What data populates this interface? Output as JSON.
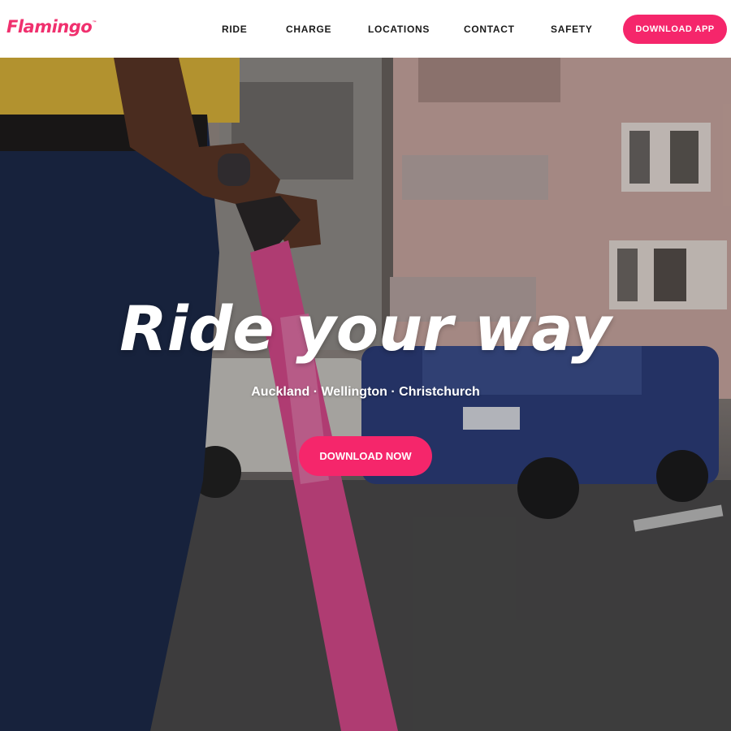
{
  "brand": {
    "name": "Flamingo",
    "trademark": "™",
    "color": "#f0306e"
  },
  "nav": {
    "items": [
      {
        "label": "RIDE"
      },
      {
        "label": "CHARGE"
      },
      {
        "label": "LOCATIONS"
      },
      {
        "label": "CONTACT"
      },
      {
        "label": "SAFETY"
      }
    ],
    "cta_label": "DOWNLOAD APP"
  },
  "hero": {
    "title": "Ride your way",
    "cities": "Auckland · Wellington · Christchurch",
    "cta_label": "DOWNLOAD NOW",
    "image_description_icon": "scooter-rider-photo"
  },
  "colors": {
    "accent": "#f5266b",
    "header_bg": "#ffffff",
    "nav_text": "#1a1a1a"
  }
}
